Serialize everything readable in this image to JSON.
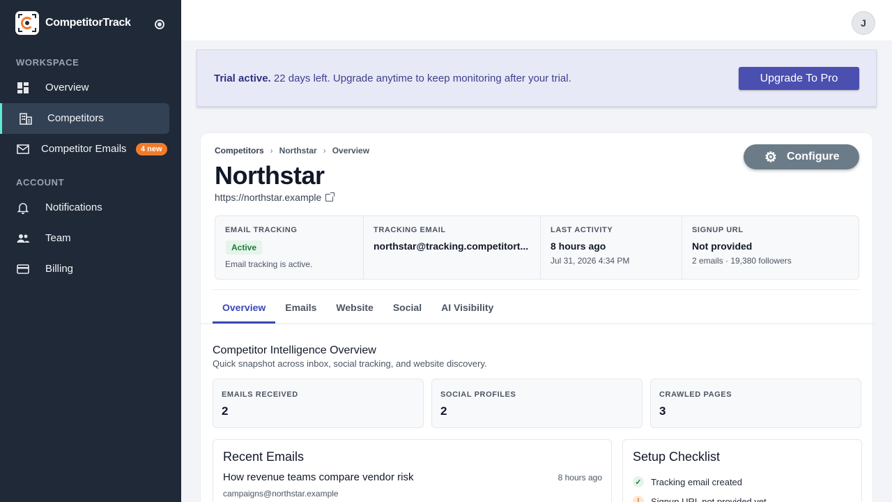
{
  "app": {
    "name": "CompetitorTrack"
  },
  "sidebar": {
    "workspace_label": "WORKSPACE",
    "account_label": "ACCOUNT",
    "workspace_items": [
      {
        "label": "Overview",
        "icon": "dashboard-icon"
      },
      {
        "label": "Competitors",
        "icon": "building-icon",
        "active": true
      },
      {
        "label": "Competitor Emails",
        "icon": "mail-icon",
        "badge": "4 new"
      }
    ],
    "account_items": [
      {
        "label": "Notifications",
        "icon": "bell-icon"
      },
      {
        "label": "Team",
        "icon": "people-icon"
      },
      {
        "label": "Billing",
        "icon": "credit-card-icon"
      }
    ]
  },
  "topbar": {
    "avatar_initial": "J"
  },
  "trial": {
    "strong": "Trial active.",
    "message": " 22 days left. Upgrade anytime to keep monitoring after your trial.",
    "button": "Upgrade To Pro"
  },
  "competitor": {
    "breadcrumb": [
      "Competitors",
      "Northstar",
      "Overview"
    ],
    "name": "Northstar",
    "url": "https://northstar.example",
    "configure_label": "Configure",
    "stats": {
      "email_tracking": {
        "label": "EMAIL TRACKING",
        "status": "Active",
        "sub": "Email tracking is active."
      },
      "tracking_email": {
        "label": "TRACKING EMAIL",
        "value": "northstar@tracking.competitort..."
      },
      "last_activity": {
        "label": "LAST ACTIVITY",
        "value": "8 hours ago",
        "sub": "Jul 31, 2026 4:34 PM"
      },
      "signup_url": {
        "label": "SIGNUP URL",
        "value": "Not provided",
        "sub": "2 emails · 19,380 followers"
      }
    }
  },
  "tabs": [
    "Overview",
    "Emails",
    "Website",
    "Social",
    "AI Visibility"
  ],
  "overview": {
    "title": "Competitor Intelligence Overview",
    "subtitle": "Quick snapshot across inbox, social tracking, and website discovery.",
    "metrics": [
      {
        "label": "EMAILS RECEIVED",
        "value": "2"
      },
      {
        "label": "SOCIAL PROFILES",
        "value": "2"
      },
      {
        "label": "CRAWLED PAGES",
        "value": "3"
      }
    ],
    "recent_emails": {
      "title": "Recent Emails",
      "items": [
        {
          "subject": "How revenue teams compare vendor risk",
          "time": "8 hours ago",
          "from": "campaigns@northstar.example"
        }
      ]
    },
    "checklist": {
      "title": "Setup Checklist",
      "items": [
        {
          "label": "Tracking email created",
          "done": true
        },
        {
          "label": "Signup URL not provided yet",
          "done": false
        }
      ]
    }
  },
  "colors": {
    "sidebar_bg": "#1f2937",
    "accent": "#3b47b8",
    "brand_orange": "#f07c2b",
    "active_marker": "#5eead4"
  }
}
